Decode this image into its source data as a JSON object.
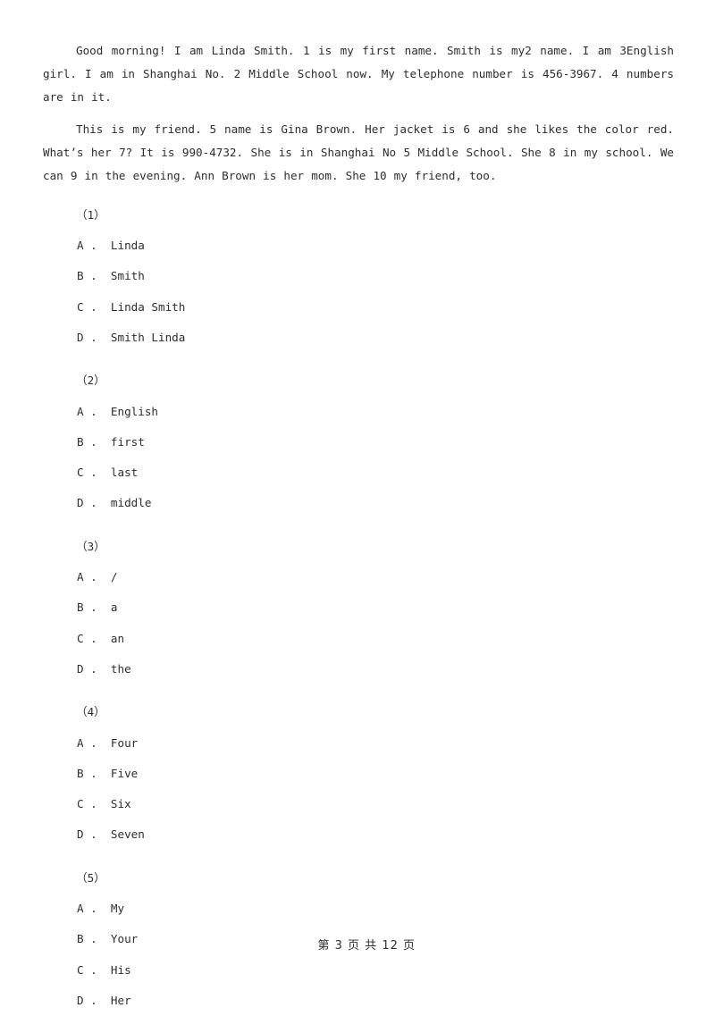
{
  "document": {
    "passages": [
      "Good morning! I am Linda Smith. 1 is my first name. Smith is my2 name. I am 3English girl. I am in Shanghai No. 2 Middle School now. My telephone number is 456-3967. 4  numbers are in it.",
      "This is my friend. 5 name is Gina Brown. Her jacket is 6 and she likes the color red. What’s her 7? It is 990-4732. She is in Shanghai No 5 Middle School. She 8 in my school. We can 9 in the evening. Ann Brown is her mom. She 10 my friend, too."
    ],
    "questions": [
      {
        "number": "（1）",
        "options": [
          "A .  Linda",
          "B .  Smith",
          "C .  Linda Smith",
          "D .  Smith Linda"
        ]
      },
      {
        "number": "（2）",
        "options": [
          "A .  English",
          "B .  first",
          "C .  last",
          "D .  middle"
        ]
      },
      {
        "number": "（3）",
        "options": [
          "A .  /",
          "B .  a",
          "C .  an",
          "D .  the"
        ]
      },
      {
        "number": "（4）",
        "options": [
          "A .  Four",
          "B .  Five",
          "C .  Six",
          "D .  Seven"
        ]
      },
      {
        "number": "（5）",
        "options": [
          "A .  My",
          "B .  Your",
          "C .  His",
          "D .  Her"
        ]
      }
    ],
    "footer": {
      "page_marker": "第 3 页 共 12 页",
      "current_page": "3",
      "total_pages": "12"
    }
  }
}
